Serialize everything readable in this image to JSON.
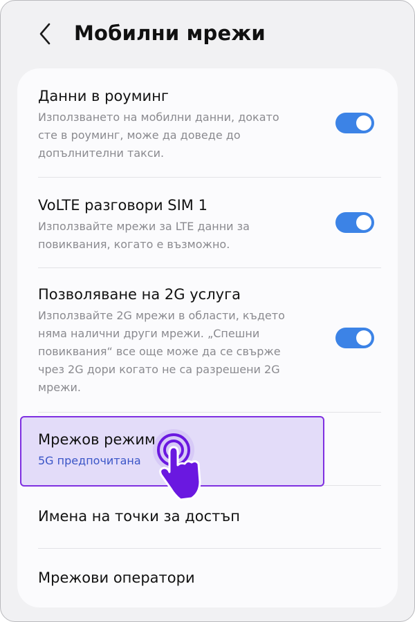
{
  "header": {
    "title": "Мобилни мрежи",
    "back_icon": "chevron-left-icon"
  },
  "settings": [
    {
      "title": "Данни в роуминг",
      "description_lines": [
        "Използването на мобилни данни, докато",
        "сте в роуминг, може да доведе до",
        "допълнителни такси."
      ],
      "toggle": "on"
    },
    {
      "title": "VoLTE разговори SIM 1",
      "description_lines": [
        "Използвайте мрежи за LTE данни за",
        "повиквания, когато е възможно."
      ],
      "toggle": "on"
    },
    {
      "title": "Позволяване на 2G услуга",
      "description_lines": [
        "Използвайте 2G мрежи в области, където",
        "няма налични други мрежи. „Спешни",
        "повиквания“ все още може да се свърже",
        "чрез 2G дори когато не са разрешени 2G",
        "мрежи."
      ],
      "toggle": "on"
    },
    {
      "title": "Мрежов режим",
      "subtitle": "5G предпочитана",
      "highlighted": true
    },
    {
      "title": "Имена на точки за достъп"
    },
    {
      "title": "Мрежови оператори"
    }
  ],
  "colors": {
    "toggle_on": "#3c83e6",
    "highlight_fill": "#e3dcf9",
    "highlight_border": "#7e2fe0",
    "subtitle_blue": "#3a55c7",
    "pointer": "#6a18e0"
  },
  "overlay": {
    "icon": "tap-hand-pointer-icon"
  }
}
